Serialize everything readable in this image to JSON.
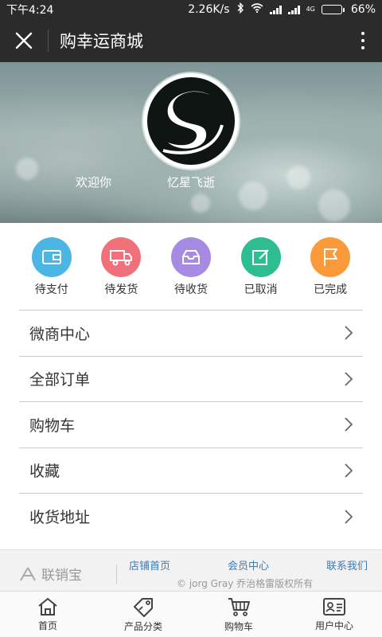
{
  "status_bar": {
    "time": "下午4:24",
    "network_speed": "2.26K/s",
    "network_type": "4G",
    "battery": "66%",
    "battery_level": 0.66
  },
  "title_bar": {
    "title": "购幸运商城",
    "close_icon": "close-icon",
    "more_icon": "more-vertical-icon"
  },
  "profile": {
    "welcome": "欢迎你",
    "nickname": "忆星飞逝"
  },
  "orders": [
    {
      "label": "待支付",
      "icon": "wallet-icon",
      "color": "#4bb6e4"
    },
    {
      "label": "待发货",
      "icon": "truck-icon",
      "color": "#f0717a"
    },
    {
      "label": "待收货",
      "icon": "inbox-icon",
      "color": "#a78be3"
    },
    {
      "label": "已取消",
      "icon": "edit-icon",
      "color": "#2ebd8e"
    },
    {
      "label": "已完成",
      "icon": "flag-icon",
      "color": "#fb9a3b"
    }
  ],
  "menu": [
    {
      "label": "微商中心"
    },
    {
      "label": "全部订单"
    },
    {
      "label": "购物车"
    },
    {
      "label": "收藏"
    },
    {
      "label": "收货地址"
    }
  ],
  "footer": {
    "brand": "联销宝",
    "links": [
      "店铺首页",
      "会员中心",
      "联系我们"
    ],
    "copyright": "© jorg Gray 乔治格雷版权所有"
  },
  "bottom_nav": [
    {
      "label": "首页",
      "icon": "home-icon"
    },
    {
      "label": "产品分类",
      "icon": "tag-icon"
    },
    {
      "label": "购物车",
      "icon": "cart-icon"
    },
    {
      "label": "用户中心",
      "icon": "user-card-icon"
    }
  ]
}
